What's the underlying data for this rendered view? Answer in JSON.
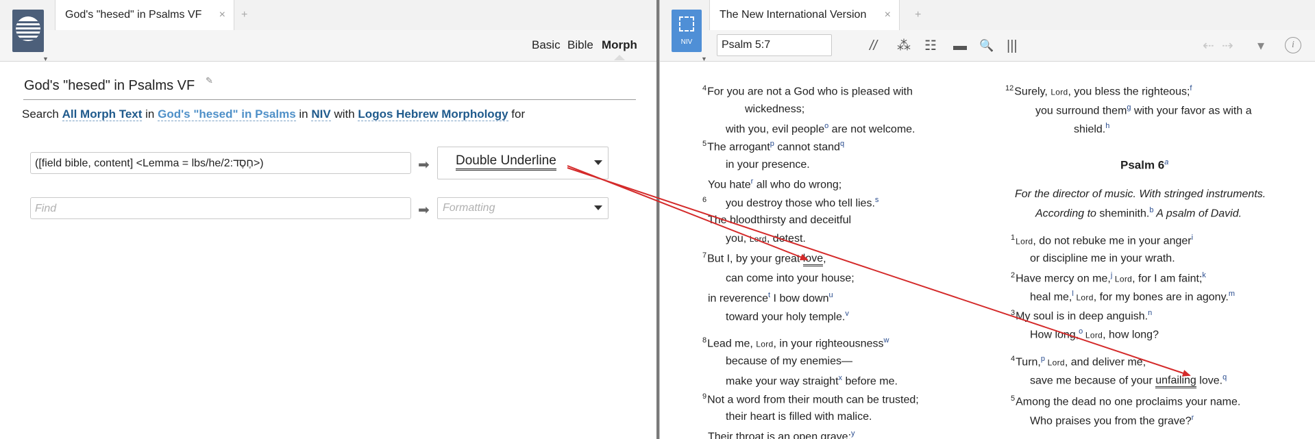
{
  "left": {
    "tab_title": "God's \"hesed\" in Psalms VF",
    "tab_close": "×",
    "tab_add": "+",
    "modes": [
      "Basic",
      "Bible",
      "Morph"
    ],
    "doc_title": "God's \"hesed\" in Psalms VF",
    "edit_icon": "✎",
    "search": {
      "w1": "Search",
      "scope": "All Morph Text",
      "w2": "in",
      "collection": "God's \"hesed\" in Psalms",
      "w3": "in",
      "version": "NIV",
      "w4": "with",
      "morphology": "Logos Hebrew Morphology",
      "w5": "for"
    },
    "query_value": "([field bible, content] <Lemma = lbs/he/2:חֶסֶד>)",
    "find_placeholder": "Find",
    "format_value": "Double Underline",
    "format_placeholder": "Formatting",
    "arrow": "➡"
  },
  "right": {
    "badge_label": "NIV",
    "tab_title": "The New International Version",
    "tab_close": "×",
    "tab_add": "+",
    "reference": "Psalm 5:7",
    "toolbar_icons": [
      "parallel-icon",
      "people-icon",
      "list-icon",
      "panel-icon",
      "search-icon",
      "columns-icon"
    ],
    "toolbar_glyphs": [
      "//",
      "⁂",
      "☷",
      "▬",
      "🔍",
      "|||"
    ],
    "nav_glyphs": [
      "⇠",
      "⇢",
      "▾"
    ],
    "info": "i",
    "col1": {
      "l1": {
        "vn": "4",
        "text": "For you are not a God who is pleased with"
      },
      "l2": "wickedness;",
      "l3a": "with you, evil people",
      "l3fn": "o",
      "l3b": " are not welcome.",
      "l4vn": "5",
      "l4a": "The arrogant",
      "l4fn1": "p",
      "l4b": " cannot stand",
      "l4fn2": "q",
      "l5": "in your presence.",
      "l6a": "You hate",
      "l6fn": "r",
      "l6b": " all who do wrong;",
      "l7vn": "6",
      "l7a": "you destroy those who tell lies.",
      "l7fn": "s",
      "l8": "The bloodthirsty and deceitful",
      "l9a": "you, ",
      "l9sc": "Lord",
      "l9b": ", detest.",
      "l10vn": "7",
      "l10a": "But I, by your great ",
      "l10u": "love",
      "l10b": ",",
      "l11": "can come into your house;",
      "l12a": "in reverence",
      "l12fn": "t",
      "l12b": " I bow down",
      "l12fn2": "u",
      "l13a": "toward your holy temple.",
      "l13fn": "v",
      "l14vn": "8",
      "l14a": "Lead me, ",
      "l14sc": "Lord",
      "l14b": ", in your righteousness",
      "l14fn": "w",
      "l15": "because of my enemies—",
      "l16a": "make your way straight",
      "l16fn": "x",
      "l16b": " before me.",
      "l17vn": "9",
      "l17a": "Not a word from their mouth can be trusted;",
      "l18": "their heart is filled with malice.",
      "l19a": "Their throat is an open grave;",
      "l19fn": "y"
    },
    "col2": {
      "l1vn": "12",
      "l1a": "Surely, ",
      "l1sc": "Lord",
      "l1b": ", you bless the righteous;",
      "l1fn": "f",
      "l2a": "you surround them",
      "l2fn": "g",
      "l2b": " with your favor as with a",
      "l3a": "shield.",
      "l3fn": "h",
      "heading": "Psalm 6",
      "headingfn": "a",
      "sub1": "For the director of music. With stringed instruments.",
      "sub2a": "According to ",
      "sub2b": "sheminith.",
      "sub2fn": "b",
      "sub2c": " A psalm of David.",
      "v1vn": "1",
      "v1sc": "Lord",
      "v1a": ", do not rebuke me in your anger",
      "v1fn": "i",
      "v1b": "or discipline me in your wrath.",
      "v2vn": "2",
      "v2a": "Have mercy on me,",
      "v2fn": "j",
      "v2sc": " Lord",
      "v2b": ", for I am faint;",
      "v2fn2": "k",
      "v2c": "heal me,",
      "v2fn3": "l",
      "v2sc2": " Lord",
      "v2d": ", for my bones are in agony.",
      "v2fn4": "m",
      "v3vn": "3",
      "v3a": "My soul is in deep anguish.",
      "v3fn": "n",
      "v3b": "How long,",
      "v3fn2": "o",
      "v3sc": " Lord",
      "v3c": ", how long?",
      "v4vn": "4",
      "v4a": "Turn,",
      "v4fn": "p",
      "v4sc": " Lord",
      "v4b": ", and deliver me;",
      "v4c": "save me because of your ",
      "v4u": "unfailing",
      "v4d": " love.",
      "v4fn2": "q",
      "v5vn": "5",
      "v5a": "Among the dead no one proclaims your name.",
      "v5b": "Who praises you from the grave?",
      "v5fn": "r"
    }
  }
}
